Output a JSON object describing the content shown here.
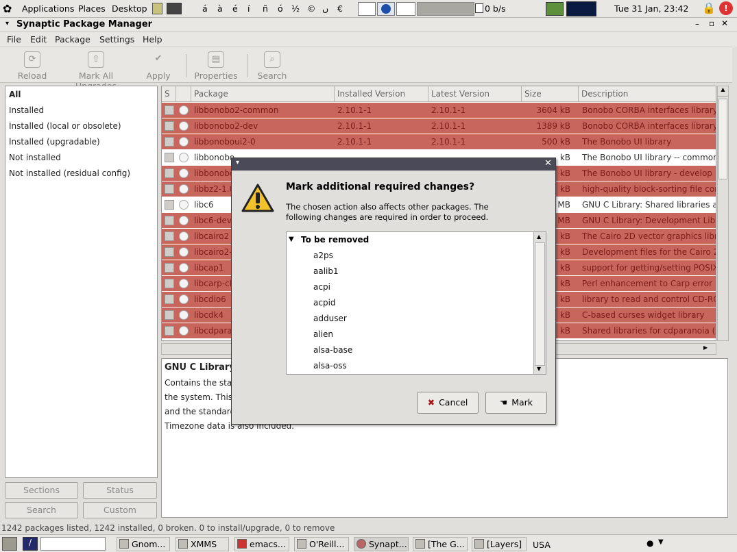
{
  "top_panel": {
    "menus": [
      "Applications",
      "Places",
      "Desktop"
    ],
    "chars": [
      "á",
      "à",
      "é",
      "í",
      "ñ",
      "ó",
      "½",
      "©",
      "ں",
      "€"
    ],
    "network": "0 b/s",
    "clock": "Tue 31 Jan, 23:42"
  },
  "window": {
    "title": "Synaptic Package Manager",
    "controls": [
      "–",
      "▫",
      "✕"
    ]
  },
  "menu": [
    "File",
    "Edit",
    "Package",
    "Settings",
    "Help"
  ],
  "toolbar": {
    "reload": "Reload",
    "mark_all": "Mark All Upgrades",
    "apply": "Apply",
    "properties": "Properties",
    "search": "Search"
  },
  "filters": [
    "All",
    "Installed",
    "Installed (local or obsolete)",
    "Installed (upgradable)",
    "Not installed",
    "Not installed (residual config)"
  ],
  "side_buttons": {
    "sections": "Sections",
    "status": "Status",
    "search": "Search",
    "custom": "Custom"
  },
  "table": {
    "headers": {
      "s": "S",
      "package": "Package",
      "installed": "Installed Version",
      "latest": "Latest Version",
      "size": "Size",
      "description": "Description"
    },
    "rows": [
      {
        "name": "libbonobo2-common",
        "installed": "2.10.1-1",
        "latest": "2.10.1-1",
        "size": "3604 kB",
        "desc": "Bonobo CORBA interfaces library"
      },
      {
        "name": "libbonobo2-dev",
        "installed": "2.10.1-1",
        "latest": "2.10.1-1",
        "size": "1389 kB",
        "desc": "Bonobo CORBA interfaces library"
      },
      {
        "name": "libbonoboui2-0",
        "installed": "2.10.1-1",
        "latest": "2.10.1-1",
        "size": "500 kB",
        "desc": "The Bonobo UI library"
      },
      {
        "name": "libbonobo",
        "installed": "",
        "latest": "",
        "size": "kB",
        "desc": "The Bonobo UI library -- common"
      },
      {
        "name": "libbonobo",
        "installed": "",
        "latest": "",
        "size": "kB",
        "desc": "The Bonobo UI library - develop"
      },
      {
        "name": "libbz2-1.0",
        "installed": "",
        "latest": "",
        "size": "kB",
        "desc": "high-quality block-sorting file com"
      },
      {
        "name": "libc6",
        "installed": "",
        "latest": "",
        "size": "MB",
        "desc": "GNU C Library: Shared libraries a"
      },
      {
        "name": "libc6-dev",
        "installed": "",
        "latest": "",
        "size": "MB",
        "desc": "GNU C Library: Development Libra"
      },
      {
        "name": "libcairo2",
        "installed": "",
        "latest": "",
        "size": "kB",
        "desc": "The Cairo 2D vector graphics libr"
      },
      {
        "name": "libcairo2-",
        "installed": "",
        "latest": "",
        "size": "kB",
        "desc": "Development files for the Cairo 2"
      },
      {
        "name": "libcap1",
        "installed": "",
        "latest": "",
        "size": "kB",
        "desc": "support for getting/setting POSIX"
      },
      {
        "name": "libcarp-cl",
        "installed": "",
        "latest": "",
        "size": "kB",
        "desc": "Perl enhancement to Carp error l"
      },
      {
        "name": "libcdio6",
        "installed": "",
        "latest": "",
        "size": "kB",
        "desc": "library to read and control CD-RO"
      },
      {
        "name": "libcdk4",
        "installed": "",
        "latest": "",
        "size": "kB",
        "desc": "C-based curses widget library"
      },
      {
        "name": "libcdpara",
        "installed": "",
        "latest": "",
        "size": "kB",
        "desc": "Shared libraries for cdparanoia ("
      }
    ]
  },
  "description": {
    "title": "GNU C Library",
    "lines": [
      "Contains the star",
      "the system. This",
      "and the standard",
      "Timezone data is also included."
    ]
  },
  "status_bar": "1242 packages listed, 1242 installed, 0 broken. 0 to install/upgrade, 0 to remove",
  "taskbar": [
    "Gnom...",
    "XMMS",
    "emacs...",
    "O'Reill...",
    "Synapt...",
    "[The G...",
    "[Layers]",
    "USA"
  ],
  "dialog": {
    "heading": "Mark additional required changes?",
    "body_1": "The chosen action also affects other packages. The",
    "body_2": "following changes are required in order to proceed.",
    "group": "To be removed",
    "packages": [
      "a2ps",
      "aalib1",
      "acpi",
      "acpid",
      "adduser",
      "alien",
      "alsa-base",
      "alsa-oss"
    ],
    "cancel": "Cancel",
    "mark": "Mark"
  },
  "colors": {
    "removed_row": "#c8655c",
    "dialog_title": "#4a4a58"
  }
}
